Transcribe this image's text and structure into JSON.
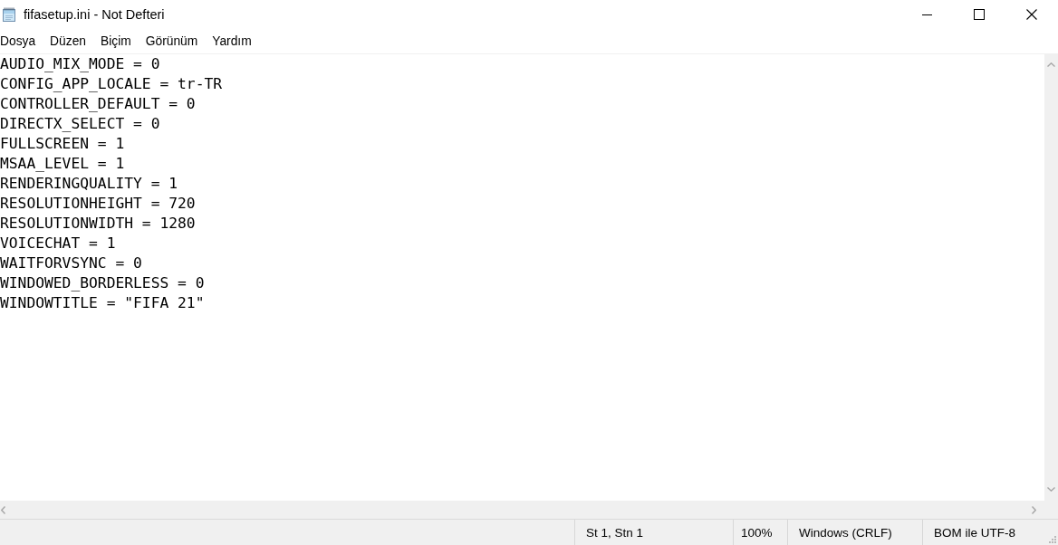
{
  "window": {
    "title": "fifasetup.ini - Not Defteri"
  },
  "menu": [
    "Dosya",
    "Düzen",
    "Biçim",
    "Görünüm",
    "Yardım"
  ],
  "editor": {
    "lines": [
      "AUDIO_MIX_MODE = 0",
      "CONFIG_APP_LOCALE = tr-TR",
      "CONTROLLER_DEFAULT = 0",
      "DIRECTX_SELECT = 0",
      "FULLSCREEN = 1",
      "MSAA_LEVEL = 1",
      "RENDERINGQUALITY = 1",
      "RESOLUTIONHEIGHT = 720",
      "RESOLUTIONWIDTH = 1280",
      "VOICECHAT = 1",
      "WAITFORVSYNC = 0",
      "WINDOWED_BORDERLESS = 0",
      "WINDOWTITLE = \"FIFA 21\""
    ]
  },
  "status_bar": [
    "St 1, Stn 1",
    "100%",
    "Windows (CRLF)",
    "BOM ile UTF-8"
  ]
}
